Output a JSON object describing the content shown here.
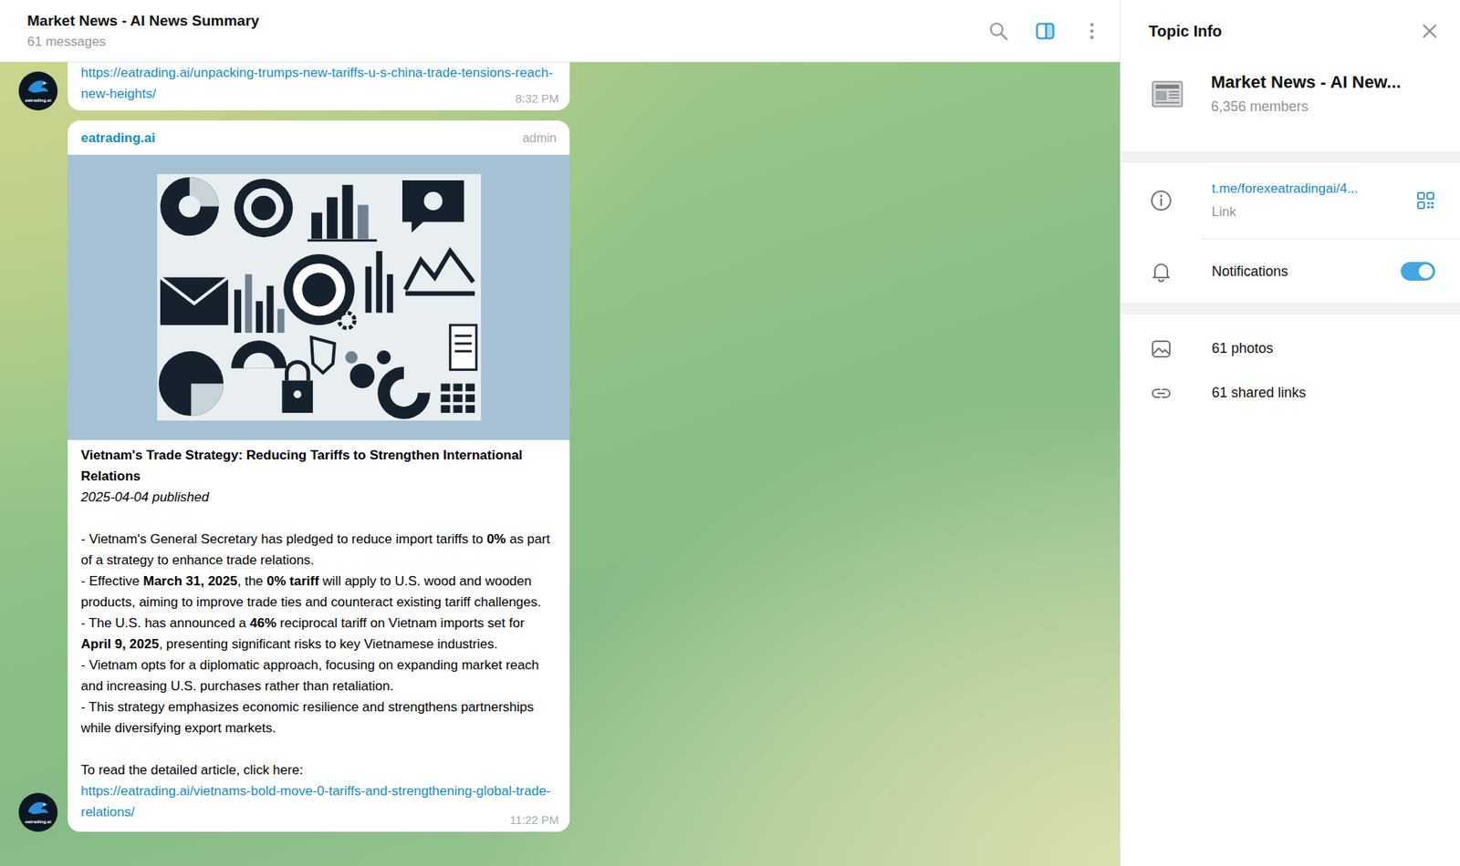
{
  "header": {
    "title": "Market News - AI News Summary",
    "subtitle": "61 messages",
    "sidebar_toggle_active": true
  },
  "messages": [
    {
      "kind": "link",
      "avatar_label": "eatrading.ai",
      "link": "https://eatrading.ai/unpacking-trumps-new-tariffs-u-s-china-trade-tensions-reach-new-heights/",
      "time": "8:32 PM"
    },
    {
      "kind": "post",
      "avatar_label": "eatrading.ai",
      "author": "eatrading.ai",
      "role": "admin",
      "title": "Vietnam's Trade Strategy: Reducing Tariffs to Strengthen International Relations",
      "date": "2025-04-04 published",
      "bullets": [
        [
          {
            "text": "- Vietnam's General Secretary has pledged to reduce import tariffs to ",
            "bold": false
          },
          {
            "text": "0%",
            "bold": true
          },
          {
            "text": " as part of a strategy to enhance trade relations.",
            "bold": false
          }
        ],
        [
          {
            "text": "- Effective ",
            "bold": false
          },
          {
            "text": "March 31, 2025",
            "bold": true
          },
          {
            "text": ", the ",
            "bold": false
          },
          {
            "text": "0% tariff",
            "bold": true
          },
          {
            "text": " will apply to U.S. wood and wooden products, aiming to improve trade ties and counteract existing tariff challenges.",
            "bold": false
          }
        ],
        [
          {
            "text": "- The U.S. has announced a ",
            "bold": false
          },
          {
            "text": "46%",
            "bold": true
          },
          {
            "text": " reciprocal tariff on Vietnam imports set for ",
            "bold": false
          },
          {
            "text": "April 9, 2025",
            "bold": true
          },
          {
            "text": ", presenting significant risks to key Vietnamese industries.",
            "bold": false
          }
        ],
        [
          {
            "text": "- Vietnam opts for a diplomatic approach, focusing on expanding market reach and increasing U.S. purchases rather than retaliation.",
            "bold": false
          }
        ],
        [
          {
            "text": "- This strategy emphasizes economic resilience and strengthens partnerships while diversifying export markets.",
            "bold": false
          }
        ]
      ],
      "read_more": "To read the detailed article, click here:",
      "link": "https://eatrading.ai/vietnams-bold-move-0-tariffs-and-strengthening-global-trade-relations/",
      "time": "11:22 PM"
    }
  ],
  "topic_info": {
    "title": "Topic Info",
    "name": "Market News - AI New...",
    "members": "6,356 members",
    "link": "t.me/forexeatradingai/4...",
    "link_label": "Link",
    "notifications": {
      "label": "Notifications",
      "on": true
    },
    "media": [
      {
        "kind": "photos",
        "label": "61 photos"
      },
      {
        "kind": "links",
        "label": "61 shared links"
      }
    ]
  }
}
